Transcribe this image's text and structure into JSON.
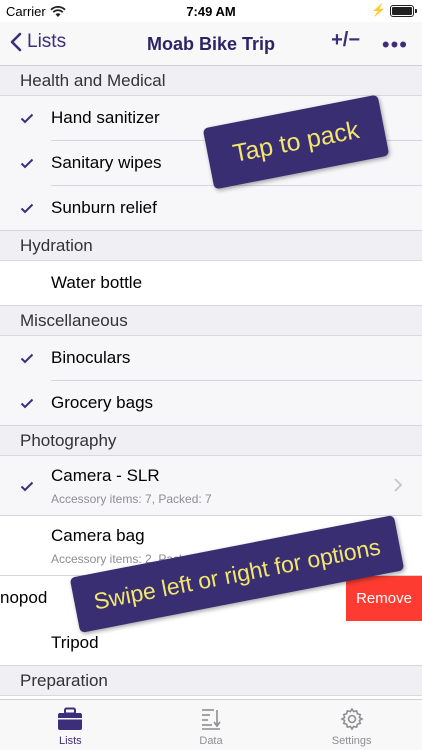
{
  "status": {
    "carrier": "Carrier",
    "time": "7:49 AM"
  },
  "nav": {
    "back_label": "Lists",
    "title": "Moab Bike Trip",
    "toggle_label": "+/−",
    "more_label": "•••"
  },
  "sections": [
    {
      "title": "Health and Medical"
    },
    {
      "title": "Hydration"
    },
    {
      "title": "Miscellaneous"
    },
    {
      "title": "Photography"
    },
    {
      "title": "Preparation"
    }
  ],
  "items": {
    "hand_sanitizer": {
      "label": "Hand sanitizer",
      "packed": true
    },
    "sanitary_wipes": {
      "label": "Sanitary wipes",
      "packed": true
    },
    "sunburn_relief": {
      "label": "Sunburn relief",
      "packed": true
    },
    "water_bottle": {
      "label": "Water bottle",
      "packed": false
    },
    "binoculars": {
      "label": "Binoculars",
      "packed": true
    },
    "grocery_bags": {
      "label": "Grocery bags",
      "packed": true
    },
    "camera_slr": {
      "label": "Camera - SLR",
      "sub": "Accessory items: 7, Packed: 7",
      "packed": true
    },
    "camera_bag": {
      "label": "Camera bag",
      "sub": "Accessory items: 2, Packed: 1",
      "packed": false
    },
    "monopod": {
      "label": "nopod",
      "action": "Remove"
    },
    "tripod": {
      "label": "Tripod",
      "packed": false
    }
  },
  "callouts": {
    "tap_to_pack": "Tap to pack",
    "swipe": "Swipe left or right for options"
  },
  "tabs": [
    {
      "label": "Lists",
      "icon": "suitcase-icon",
      "active": true
    },
    {
      "label": "Data",
      "icon": "data-sort-icon",
      "active": false
    },
    {
      "label": "Settings",
      "icon": "gear-icon",
      "active": false
    }
  ],
  "colors": {
    "accent": "#3d2e7a",
    "callout_bg": "#3a2e73",
    "callout_text": "#f2e66d",
    "remove": "#fd3b30"
  }
}
